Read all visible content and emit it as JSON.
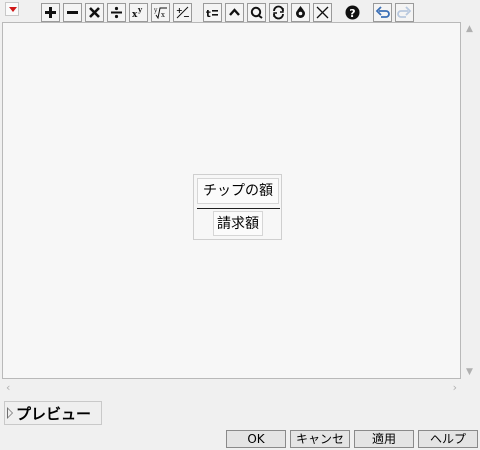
{
  "window": {
    "menu_icon": "red-triangle-menu-icon"
  },
  "toolbar": [
    {
      "name": "add-icon",
      "glyph": "+"
    },
    {
      "name": "subtract-icon",
      "glyph": "−"
    },
    {
      "name": "multiply-icon",
      "glyph": "×"
    },
    {
      "name": "divide-icon",
      "glyph": "÷"
    },
    {
      "name": "power-icon",
      "glyph": "xʸ"
    },
    {
      "name": "root-icon",
      "glyph": "ʸ√x"
    },
    {
      "name": "plus-minus-icon",
      "glyph": "±"
    },
    {
      "name": "assign-icon",
      "glyph": "t="
    },
    {
      "name": "peel-icon",
      "glyph": "^"
    },
    {
      "name": "unary-icon",
      "glyph": "ℚ"
    },
    {
      "name": "swap-icon",
      "glyph": "↻"
    },
    {
      "name": "local-icon",
      "glyph": "⊕"
    },
    {
      "name": "delete-icon",
      "glyph": "✕"
    },
    {
      "name": "help-icon",
      "glyph": "?"
    },
    {
      "name": "undo-icon",
      "glyph": "↶"
    },
    {
      "name": "redo-icon",
      "glyph": "↷"
    }
  ],
  "formula": {
    "numerator": "チップの額",
    "denominator": "請求額"
  },
  "preview": {
    "label": "プレビュー"
  },
  "buttons": {
    "ok": "OK",
    "cancel": "キャンセル",
    "apply": "適用",
    "help": "ヘルプ"
  },
  "colors": {
    "menu_triangle": "#d01818",
    "undo_active": "#3b6fb6",
    "redo_disabled": "#b8c8de"
  }
}
